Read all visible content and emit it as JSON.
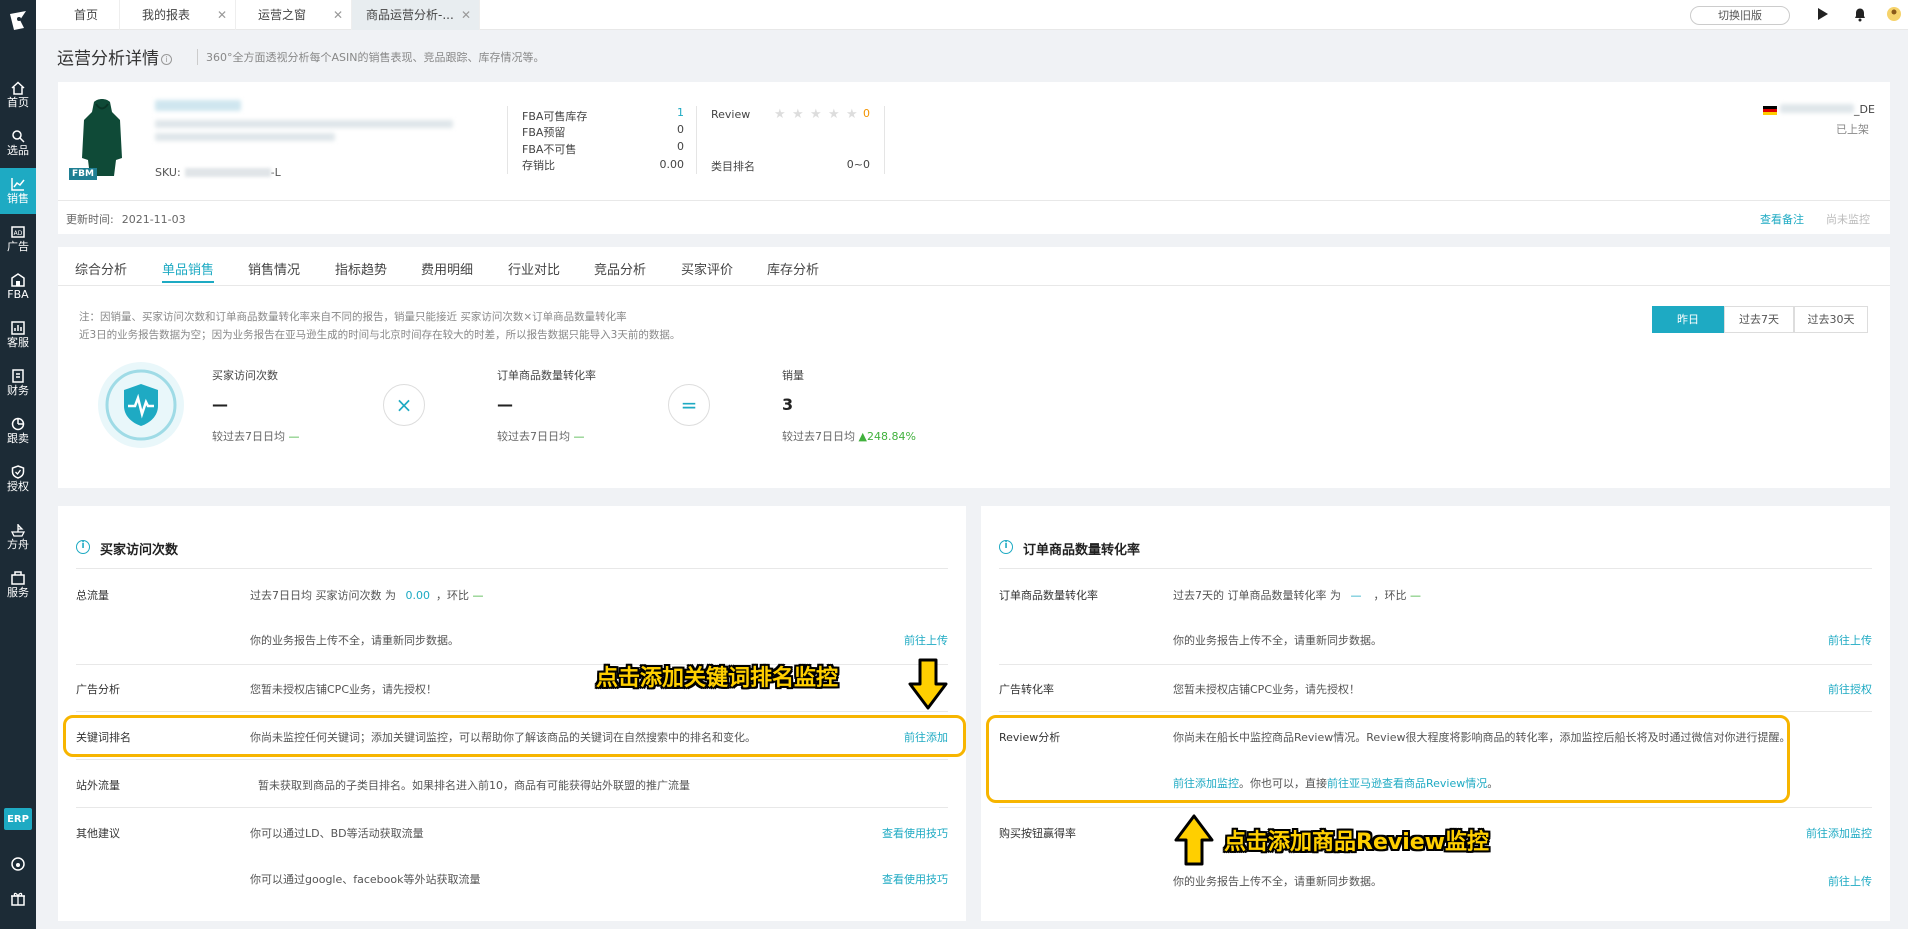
{
  "sidebar": {
    "items": [
      {
        "label": "首页",
        "icon": "home-icon"
      },
      {
        "label": "选品",
        "icon": "search-icon"
      },
      {
        "label": "销售",
        "icon": "chart-icon"
      },
      {
        "label": "广告",
        "icon": "ad-icon"
      },
      {
        "label": "FBA",
        "icon": "warehouse-icon"
      },
      {
        "label": "客服",
        "icon": "service-icon"
      },
      {
        "label": "财务",
        "icon": "finance-icon"
      },
      {
        "label": "跟卖",
        "icon": "pie-icon"
      },
      {
        "label": "授权",
        "icon": "shield-icon"
      },
      {
        "label": "方舟",
        "icon": "ark-icon"
      },
      {
        "label": "服务",
        "icon": "service-center-icon"
      }
    ],
    "erp": "ERP"
  },
  "topbar": {
    "tabs": [
      {
        "label": "首页"
      },
      {
        "label": "我的报表"
      },
      {
        "label": "运营之窗"
      },
      {
        "label": "商品运营分析-..."
      }
    ],
    "switch_label": "切换旧版"
  },
  "page": {
    "title": "运营分析详情",
    "desc": "360°全方面透视分析每个ASIN的销售表现、竞品跟踪、库存情况等。"
  },
  "product": {
    "badge": "FBM",
    "sku_label": "SKU:",
    "sku_suffix": "-L",
    "fba": [
      {
        "label": "FBA可售库存",
        "value": "1"
      },
      {
        "label": "FBA预留",
        "value": "0"
      },
      {
        "label": "FBA不可售",
        "value": "0"
      },
      {
        "label": "存销比",
        "value": "0.00"
      }
    ],
    "review_label": "Review",
    "review_value": "0",
    "rank_label": "类目排名",
    "rank_value": "0~0",
    "store_suffix": "_DE",
    "status": "已上架",
    "update_label": "更新时间:",
    "update_value": "2021-11-03",
    "view_notes": "查看备注",
    "not_monitored": "尚未监控"
  },
  "tabs": [
    {
      "label": "综合分析"
    },
    {
      "label": "单品销售"
    },
    {
      "label": "销售情况"
    },
    {
      "label": "指标趋势"
    },
    {
      "label": "费用明细"
    },
    {
      "label": "行业对比"
    },
    {
      "label": "竞品分析"
    },
    {
      "label": "买家评价"
    },
    {
      "label": "库存分析"
    }
  ],
  "notes": {
    "line1": "注：因销量、买家访问次数和订单商品数量转化率来自不同的报告，销量只能接近 买家访问次数×订单商品数量转化率",
    "line2": "近3日的业务报告数据为空；因为业务报告在亚马逊生成的时间与北京时间存在较大的时差，所以报告数据只能导入3天前的数据。"
  },
  "range": {
    "yesterday": "昨日",
    "d7": "过去7天",
    "d30": "过去30天"
  },
  "metrics": {
    "visits": {
      "label": "买家访问次数",
      "value": "—",
      "cmp": "较过去7日日均",
      "delta": "—"
    },
    "times": "×",
    "conversion": {
      "label": "订单商品数量转化率",
      "value": "—",
      "cmp": "较过去7日日均",
      "delta": "—"
    },
    "equals": "=",
    "sales": {
      "label": "销量",
      "value": "3",
      "cmp": "较过去7日日均",
      "delta": "248.84%"
    }
  },
  "left_section": {
    "title": "买家访问次数",
    "rows": {
      "total_label": "总流量",
      "total_text_a": "过去7日日均 买家访问次数 为",
      "total_value": "0.00",
      "total_text_b": "，环比",
      "total_delta": "—",
      "total_text2": "你的业务报告上传不全，请重新同步数据。",
      "total_link": "前往上传",
      "ad_label": "广告分析",
      "ad_text": "您暂未授权店铺CPC业务，请先授权！",
      "kw_label": "关键词排名",
      "kw_text": "你尚未监控任何关键词；添加关键词监控，可以帮助你了解该商品的关键词在自然搜索中的排名和变化。",
      "kw_link": "前往添加",
      "site_label": "站外流量",
      "site_text": "暂未获取到商品的子类目排名。如果排名进入前10，商品有可能获得站外联盟的推广流量",
      "other_label": "其他建议",
      "other_text1": "你可以通过LD、BD等活动获取流量",
      "other_link1": "查看使用技巧",
      "other_text2": "你可以通过google、facebook等外站获取流量",
      "other_link2": "查看使用技巧"
    }
  },
  "right_section": {
    "title": "订单商品数量转化率",
    "rows": {
      "conv_label": "订单商品数量转化率",
      "conv_text_a": "过去7天的 订单商品数量转化率 为",
      "conv_value": "—",
      "conv_text_b": "，环比",
      "conv_delta": "—",
      "conv_text2": "你的业务报告上传不全，请重新同步数据。",
      "conv_link": "前往上传",
      "adc_label": "广告转化率",
      "adc_text": "您暂未授权店铺CPC业务，请先授权！",
      "adc_link": "前往授权",
      "review_label": "Review分析",
      "review_text": "你尚未在船长中监控商品Review情况。Review很大程度将影响商品的转化率，添加监控后船长将及时通过微信对你进行提醒。",
      "review_link1": "前往添加监控",
      "review_mid": "。你也可以，直接",
      "review_link2": "前往亚马逊查看商品Review情况",
      "review_end": "。",
      "buybox_label": "购买按钮赢得率",
      "buybox_link": "前往添加监控",
      "buybox_text2": "你的业务报告上传不全，请重新同步数据。",
      "buybox_link2": "前往上传"
    }
  },
  "annotations": {
    "keyword": "点击添加关键词排名监控",
    "review": "点击添加商品Review监控"
  },
  "colors": {
    "accent": "#1eaac3",
    "sidebar": "#1c2b36",
    "highlight": "#f7b500",
    "annotation": "#ffcf00"
  }
}
